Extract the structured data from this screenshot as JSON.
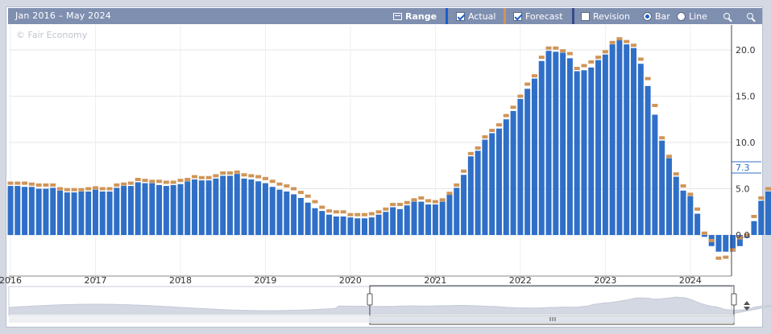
{
  "toolbar": {
    "range_text": "Jan 2016 – May 2024",
    "range_label": "Range",
    "actual_label": "Actual",
    "forecast_label": "Forecast",
    "revision_label": "Revision",
    "bar_label": "Bar",
    "line_label": "Line",
    "actual_checked": true,
    "forecast_checked": true,
    "revision_checked": false,
    "mode": "bar"
  },
  "watermark": "© Fair Economy",
  "colors": {
    "actual": "#2f6fc7",
    "forecast": "#cf9558",
    "toolbar": "#7f8fb0",
    "accent": "#1a5fc8",
    "navigator_fill": "#d3d8e3"
  },
  "chart_data": {
    "type": "bar",
    "x_start": "2016-01",
    "x_end": "2024-05",
    "ylim": [
      -3.2,
      22.8
    ],
    "y_ticks": [
      "0.0",
      "5.0",
      "10.0",
      "15.0",
      "20.0"
    ],
    "x_tick_labels": [
      "2016",
      "2017",
      "2018",
      "2019",
      "2020",
      "2021",
      "2022",
      "2023",
      "2024"
    ],
    "last_value_label": "7.3",
    "series": [
      {
        "name": "Actual",
        "values": [
          5.3,
          5.3,
          5.2,
          5.2,
          5.0,
          5.0,
          5.1,
          4.8,
          4.6,
          4.6,
          4.7,
          4.7,
          4.9,
          4.7,
          4.7,
          5.1,
          5.3,
          5.3,
          5.7,
          5.6,
          5.6,
          5.4,
          5.3,
          5.4,
          5.5,
          5.8,
          6.0,
          5.9,
          5.9,
          6.1,
          6.4,
          6.4,
          6.6,
          6.1,
          6.0,
          5.8,
          5.6,
          5.2,
          4.9,
          4.7,
          4.4,
          4.0,
          3.5,
          2.9,
          2.6,
          2.2,
          2.0,
          2.0,
          1.9,
          1.8,
          1.8,
          1.9,
          2.2,
          2.5,
          3.0,
          2.8,
          3.2,
          3.6,
          3.6,
          3.3,
          3.3,
          3.6,
          4.4,
          5.1,
          6.5,
          8.5,
          9.1,
          10.3,
          11.0,
          11.5,
          12.5,
          13.4,
          14.7,
          15.8,
          16.9,
          18.8,
          19.9,
          19.8,
          19.7,
          19.1,
          17.7,
          17.8,
          18.1,
          18.9,
          19.5,
          20.6,
          21.2,
          20.6,
          20.2,
          18.5,
          16.1,
          13.0,
          10.2,
          8.3,
          6.3,
          4.8,
          4.2,
          2.3,
          -0.2,
          -1.2,
          -1.8,
          -1.8,
          -1.8,
          -1.2,
          -0.3,
          1.5,
          3.7,
          4.7,
          5.4,
          5.8,
          6.2,
          6.4,
          7.3
        ],
        "color": "#2f6fc7"
      },
      {
        "name": "Forecast",
        "values": [
          5.6,
          5.6,
          5.6,
          5.5,
          5.4,
          5.4,
          5.4,
          5.0,
          4.9,
          4.9,
          4.9,
          5.0,
          5.1,
          5.0,
          5.0,
          5.4,
          5.5,
          5.6,
          6.0,
          5.9,
          5.8,
          5.8,
          5.7,
          5.7,
          5.9,
          6.0,
          6.3,
          6.2,
          6.2,
          6.4,
          6.7,
          6.7,
          6.8,
          6.5,
          6.4,
          6.3,
          6.1,
          5.8,
          5.5,
          5.3,
          5.0,
          4.6,
          4.2,
          3.6,
          3.0,
          2.6,
          2.5,
          2.5,
          2.2,
          2.2,
          2.2,
          2.3,
          2.5,
          2.8,
          3.3,
          3.3,
          3.5,
          3.8,
          4.0,
          3.7,
          3.6,
          3.8,
          4.5,
          5.4,
          6.9,
          8.8,
          9.4,
          10.6,
          11.3,
          11.9,
          12.9,
          13.8,
          15.0,
          16.3,
          17.2,
          19.2,
          20.2,
          20.2,
          19.9,
          19.6,
          18.0,
          18.3,
          18.7,
          19.2,
          19.8,
          20.8,
          21.2,
          20.9,
          20.5,
          19.0,
          16.9,
          14.0,
          10.5,
          8.5,
          6.6,
          5.3,
          4.4,
          2.8,
          0.2,
          -0.6,
          -2.5,
          -2.4,
          -1.6,
          -0.3,
          0.0,
          2.0,
          4.0,
          5.0,
          5.6,
          6.0,
          6.2,
          6.7,
          6.5
        ]
      }
    ],
    "navigator": {
      "x_start": "2009-01",
      "x_end": "2024-05",
      "selected_start": "2016-01",
      "selected_end": "2024-05"
    }
  }
}
